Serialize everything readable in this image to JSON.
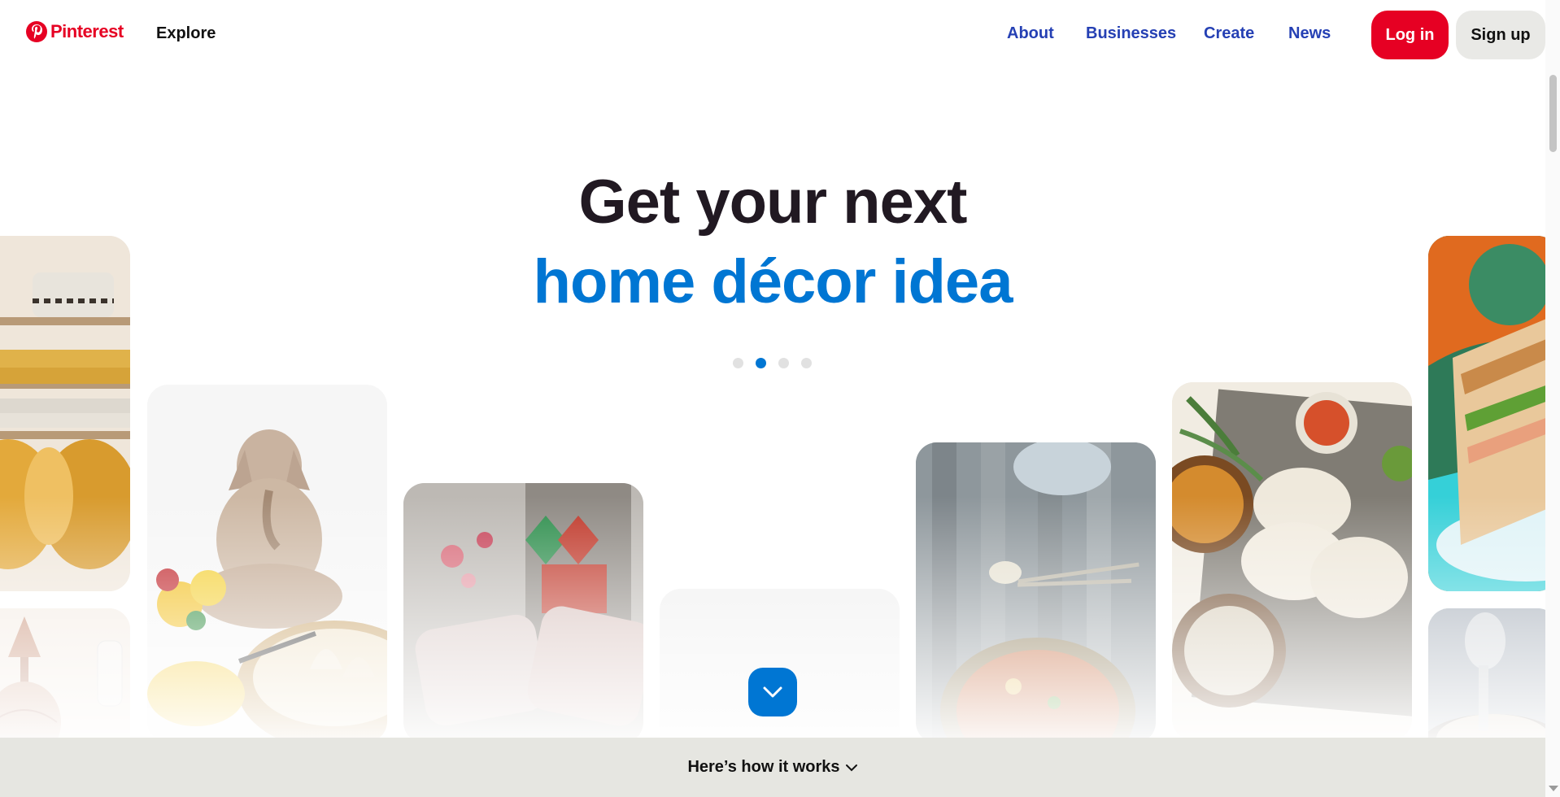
{
  "header": {
    "logo_text": "Pinterest",
    "explore_label": "Explore",
    "nav": [
      "About",
      "Businesses",
      "Create",
      "News"
    ],
    "login_label": "Log in",
    "signup_label": "Sign up"
  },
  "hero": {
    "line1": "Get your next",
    "line2": "home décor idea",
    "carousel_total": 4,
    "carousel_active": 2
  },
  "footer_bar": {
    "label": "Here’s how it works"
  },
  "colors": {
    "brand": "#e60023",
    "accent": "#0076d3",
    "link": "#2540b4"
  },
  "cards": [
    {
      "name": "card-shelves-cushions",
      "subject": "shelves with mustard cushions"
    },
    {
      "name": "card-ganesha-idol",
      "subject": "ganesha idol with flowers and modak"
    },
    {
      "name": "card-cushions-window",
      "subject": "printed cushions by window"
    },
    {
      "name": "card-blank",
      "subject": "light grey card"
    },
    {
      "name": "card-spoon-dish",
      "subject": "spoon with dish on wood"
    },
    {
      "name": "card-idli",
      "subject": "idli with chutneys"
    },
    {
      "name": "card-sandwich",
      "subject": "grilled sandwich on blue plate"
    },
    {
      "name": "card-lamp-decor",
      "subject": "decorative lamp"
    },
    {
      "name": "card-strainer",
      "subject": "kitchen strainer"
    }
  ]
}
